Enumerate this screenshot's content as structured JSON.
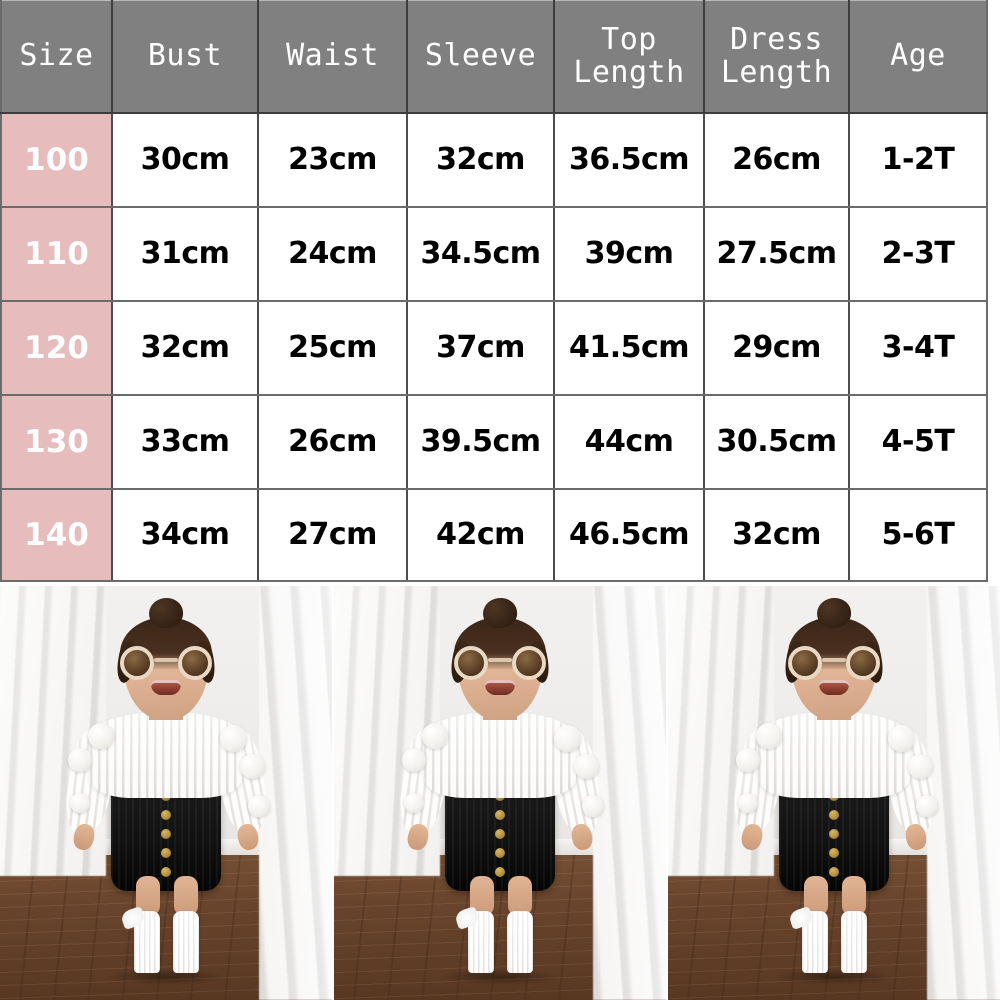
{
  "size_chart": {
    "columns": [
      "Size",
      "Bust",
      "Waist",
      "Sleeve",
      "Top Length",
      "Dress Length",
      "Age"
    ],
    "header_lines": [
      [
        "Size"
      ],
      [
        "Bust"
      ],
      [
        "Waist"
      ],
      [
        "Sleeve"
      ],
      [
        "Top",
        "Length"
      ],
      [
        "Dress",
        "Length"
      ],
      [
        "Age"
      ]
    ],
    "rows": [
      {
        "size": "100",
        "bust": "30cm",
        "waist": "23cm",
        "sleeve": "32cm",
        "top_length": "36.5cm",
        "dress_length": "26cm",
        "age": "1-2T"
      },
      {
        "size": "110",
        "bust": "31cm",
        "waist": "24cm",
        "sleeve": "34.5cm",
        "top_length": "39cm",
        "dress_length": "27.5cm",
        "age": "2-3T"
      },
      {
        "size": "120",
        "bust": "32cm",
        "waist": "25cm",
        "sleeve": "37cm",
        "top_length": "41.5cm",
        "dress_length": "29cm",
        "age": "3-4T"
      },
      {
        "size": "130",
        "bust": "33cm",
        "waist": "26cm",
        "sleeve": "39.5cm",
        "top_length": "44cm",
        "dress_length": "30.5cm",
        "age": "4-5T"
      },
      {
        "size": "140",
        "bust": "34cm",
        "waist": "27cm",
        "sleeve": "42cm",
        "top_length": "46.5cm",
        "dress_length": "32cm",
        "age": "5-6T"
      }
    ],
    "colors": {
      "header_background": "#808080",
      "header_text": "#ffffff",
      "size_column_background": "#e6bcbc",
      "size_column_text": "#ffffff",
      "value_text": "#000000",
      "cell_background": "#ffffff",
      "grid_line": "#4d4d4d"
    }
  },
  "photo_gallery": {
    "count": 3,
    "photos": [
      {
        "alt": "Toddler girl wearing white pompom knit sweater and black button-front skirt with round sunglasses"
      },
      {
        "alt": "Toddler girl wearing white pompom knit sweater and black button-front skirt with round sunglasses"
      },
      {
        "alt": "Toddler girl wearing white pompom knit sweater and black button-front skirt with round sunglasses"
      }
    ]
  }
}
